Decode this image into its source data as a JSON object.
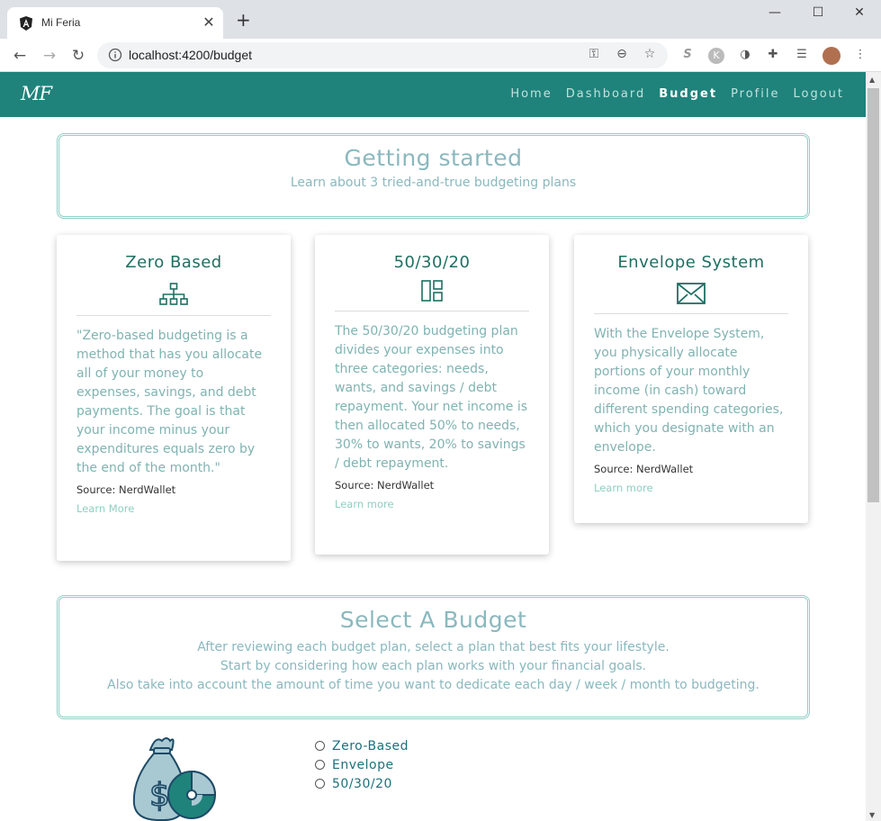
{
  "browser": {
    "tab_title": "Mi Feria",
    "url": "localhost:4200/budget",
    "new_tab": "+",
    "close": "✕",
    "minimize": "—",
    "maximize": "☐",
    "win_close": "✕"
  },
  "app": {
    "logo": "MF",
    "nav": [
      "Home",
      "Dashboard",
      "Budget",
      "Profile",
      "Logout"
    ],
    "active_nav": "Budget"
  },
  "getting_started": {
    "title": "Getting started",
    "subtitle": "Learn about 3 tried-and-true budgeting plans"
  },
  "cards": [
    {
      "title": "Zero Based",
      "icon": "org-chart-icon",
      "body": "\"Zero-based budgeting is a method that has you allocate all of your money to expenses, savings, and debt payments. The goal is that your income minus your expenditures equals zero by the end of the month.\"",
      "source": "Source: NerdWallet",
      "link": "Learn More"
    },
    {
      "title": "50/30/20",
      "icon": "layout-icon",
      "body": "The 50/30/20 budgeting plan divides your expenses into three categories: needs, wants, and savings / debt repayment. Your net income is then allocated 50% to needs, 30% to wants, 20% to savings / debt repayment.",
      "source": "Source: NerdWallet",
      "link": "Learn more"
    },
    {
      "title": "Envelope System",
      "icon": "envelope-icon",
      "body": "With the Envelope System, you physically allocate portions of your monthly income (in cash) toward different spending categories, which you designate with an envelope.",
      "source": "Source: NerdWallet",
      "link": "Learn more"
    }
  ],
  "select_budget": {
    "title": "Select A Budget",
    "lines": [
      "After reviewing each budget plan, select a plan that best fits your lifestyle.",
      "Start by considering how each plan works with your financial goals.",
      "Also take into account the amount of time you want to dedicate each day / week / month to budgeting."
    ]
  },
  "options": [
    "Zero-Based",
    "Envelope",
    "50/30/20"
  ],
  "colors": {
    "brand": "#1f837b",
    "heading": "#8ab8be",
    "card_title": "#1f6f62",
    "body_text": "#80b3b1",
    "link": "#8fcfc0"
  }
}
